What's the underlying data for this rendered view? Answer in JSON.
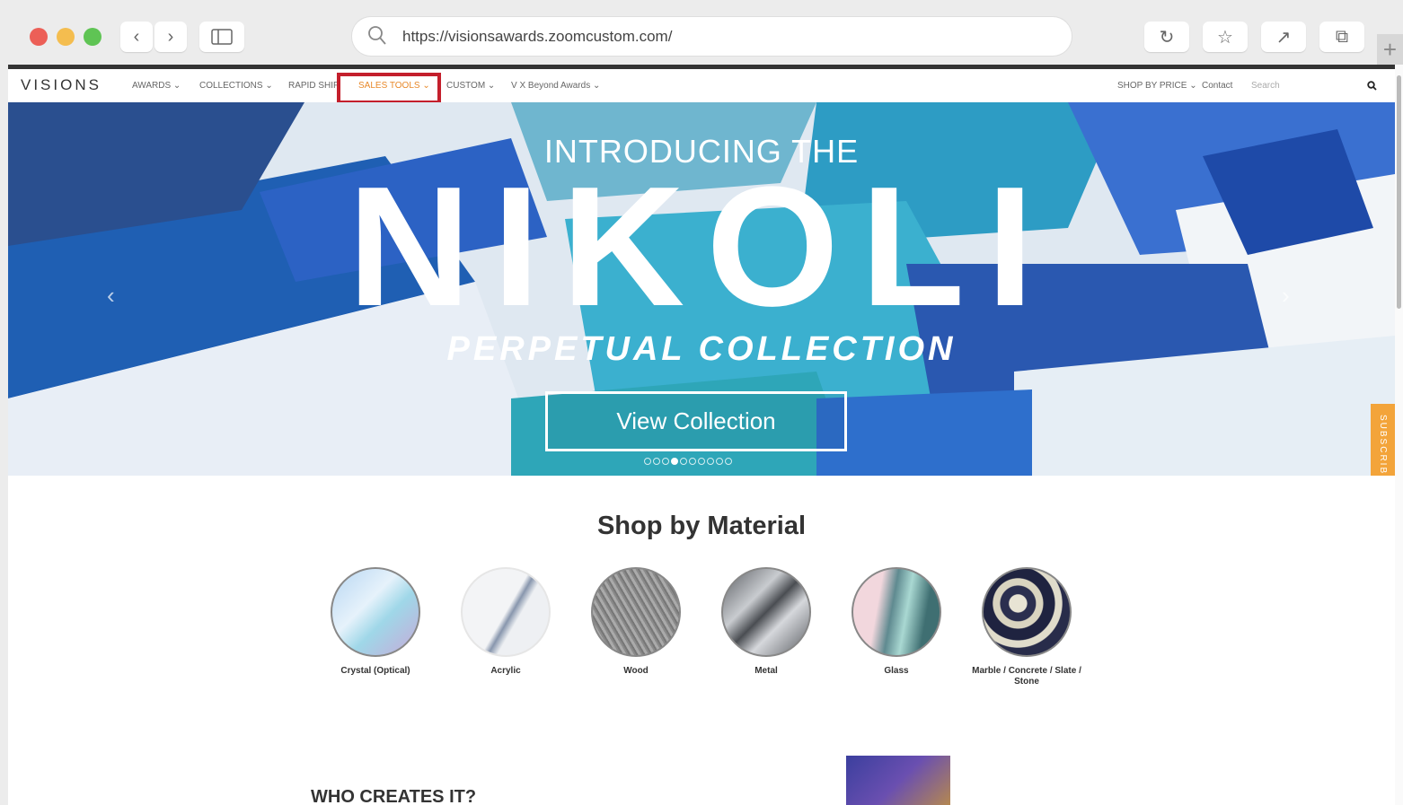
{
  "browser": {
    "url": "https://visionsawards.zoomcustom.com/",
    "colors": {
      "close": "#ec5f57",
      "minimize": "#f4bd4f",
      "zoom": "#5fc454"
    }
  },
  "site": {
    "logo": "VISIONS",
    "nav": {
      "awards": "AWARDS ⌄",
      "collections": "COLLECTIONS ⌄",
      "rapid_ship": "RAPID SHIP",
      "sales_tools": "SALES TOOLS ⌄",
      "custom": "CUSTOM ⌄",
      "vx": "V X Beyond Awards ⌄",
      "shop_by_price": "SHOP BY PRICE ⌄",
      "contact": "Contact",
      "search_placeholder": "Search"
    },
    "hero": {
      "introducing": "INTRODUCING THE",
      "headline": "NIKOLI",
      "subtitle": "PERPETUAL COLLECTION",
      "button": "View Collection",
      "slide_count": 10,
      "active_slide": 3
    },
    "subscribe": "SUBSCRIBE",
    "shop_title": "Shop by Material",
    "materials": [
      {
        "label": "Crystal (Optical)"
      },
      {
        "label": "Acrylic"
      },
      {
        "label": "Wood"
      },
      {
        "label": "Metal"
      },
      {
        "label": "Glass"
      },
      {
        "label": "Marble / Concrete / Slate / Stone"
      }
    ],
    "who_title": "WHO CREATES IT?"
  }
}
